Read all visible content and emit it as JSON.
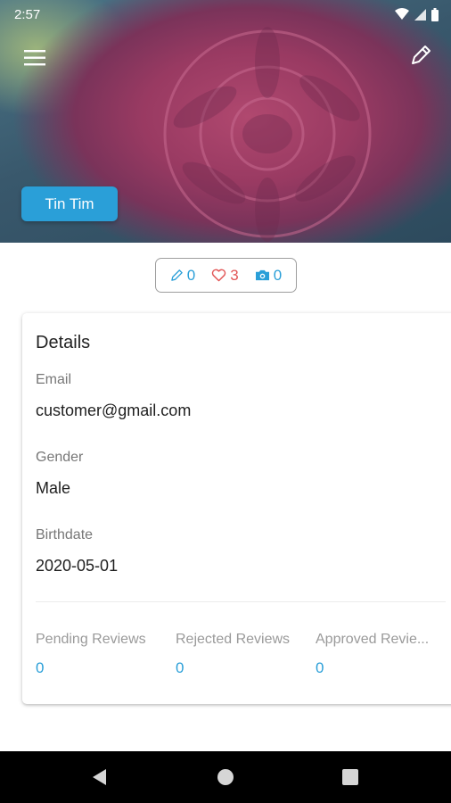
{
  "status_bar": {
    "time": "2:57"
  },
  "header": {
    "user_name": "Tin Tim",
    "icons": [
      "menu-icon",
      "edit-icon"
    ]
  },
  "stats": {
    "reviews": "0",
    "likes": "3",
    "photos": "0",
    "colors": {
      "blue": "#2a9fd8",
      "red": "#e25555"
    }
  },
  "details": {
    "title": "Details",
    "email_label": "Email",
    "email": "customer@gmail.com",
    "gender_label": "Gender",
    "gender": "Male",
    "birthdate_label": "Birthdate",
    "birthdate": "2020-05-01"
  },
  "reviews": [
    {
      "label": "Pending Reviews",
      "count": "0"
    },
    {
      "label": "Rejected Reviews",
      "count": "0"
    },
    {
      "label": "Approved Revie...",
      "count": "0"
    }
  ],
  "navbar": {
    "icons": [
      "back-icon",
      "home-icon",
      "recents-icon"
    ]
  }
}
